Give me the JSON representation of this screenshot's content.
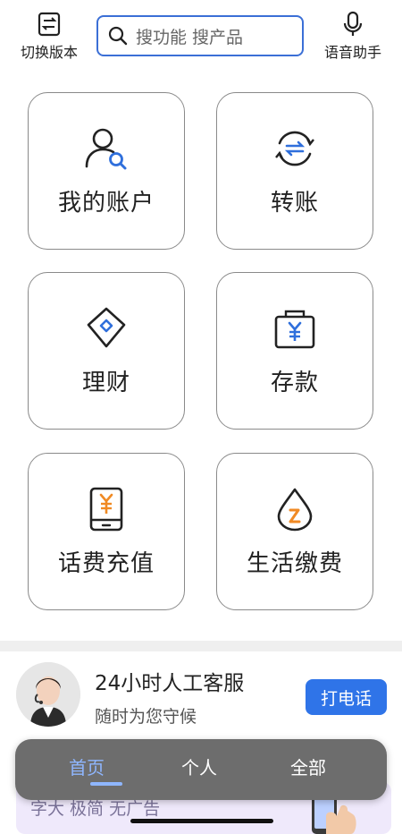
{
  "header": {
    "switch_label": "切换版本",
    "search_placeholder": "搜功能 搜产品",
    "voice_label": "语音助手"
  },
  "tiles": [
    {
      "label": "我的账户",
      "icon": "account-search-icon"
    },
    {
      "label": "转账",
      "icon": "transfer-icon"
    },
    {
      "label": "理财",
      "icon": "diamond-icon"
    },
    {
      "label": "存款",
      "icon": "deposit-bag-icon"
    },
    {
      "label": "话费充值",
      "icon": "phone-topup-icon"
    },
    {
      "label": "生活缴费",
      "icon": "utility-drop-icon"
    }
  ],
  "service": {
    "title": "24小时人工客服",
    "subtitle": "随时为您守候",
    "call_label": "打电话"
  },
  "promo": {
    "text": "字大 极简 无广告"
  },
  "nav": {
    "items": [
      "首页",
      "个人",
      "全部"
    ],
    "active_index": 0
  },
  "colors": {
    "accent": "#2f74e8",
    "icon_blue": "#2f6fdc",
    "icon_orange": "#f08a24",
    "nav_bg": "#6d6d6d"
  }
}
